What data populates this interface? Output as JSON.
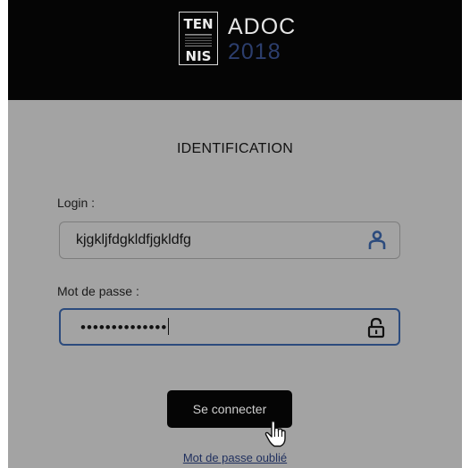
{
  "header": {
    "logo_line1": "TEN",
    "logo_line2": "NIS",
    "brand_name": "ADOC",
    "brand_year": "2018"
  },
  "form": {
    "title": "IDENTIFICATION",
    "login_label": "Login :",
    "login_value": "kjgkljfdgkldfjgkldfg",
    "password_label": "Mot de passe :",
    "password_value": "••••••••••••••",
    "submit_label": "Se connecter",
    "forgot_link": "Mot de passe oublié"
  },
  "icons": {
    "login": "user-icon",
    "password": "lock-icon",
    "cursor": "hand-pointer-icon"
  },
  "colors": {
    "header_bg": "#050505",
    "panel_bg": "#a3a3a3",
    "accent": "#2c4b7d",
    "year": "#2c3e6d",
    "link": "#1f2f5e"
  }
}
